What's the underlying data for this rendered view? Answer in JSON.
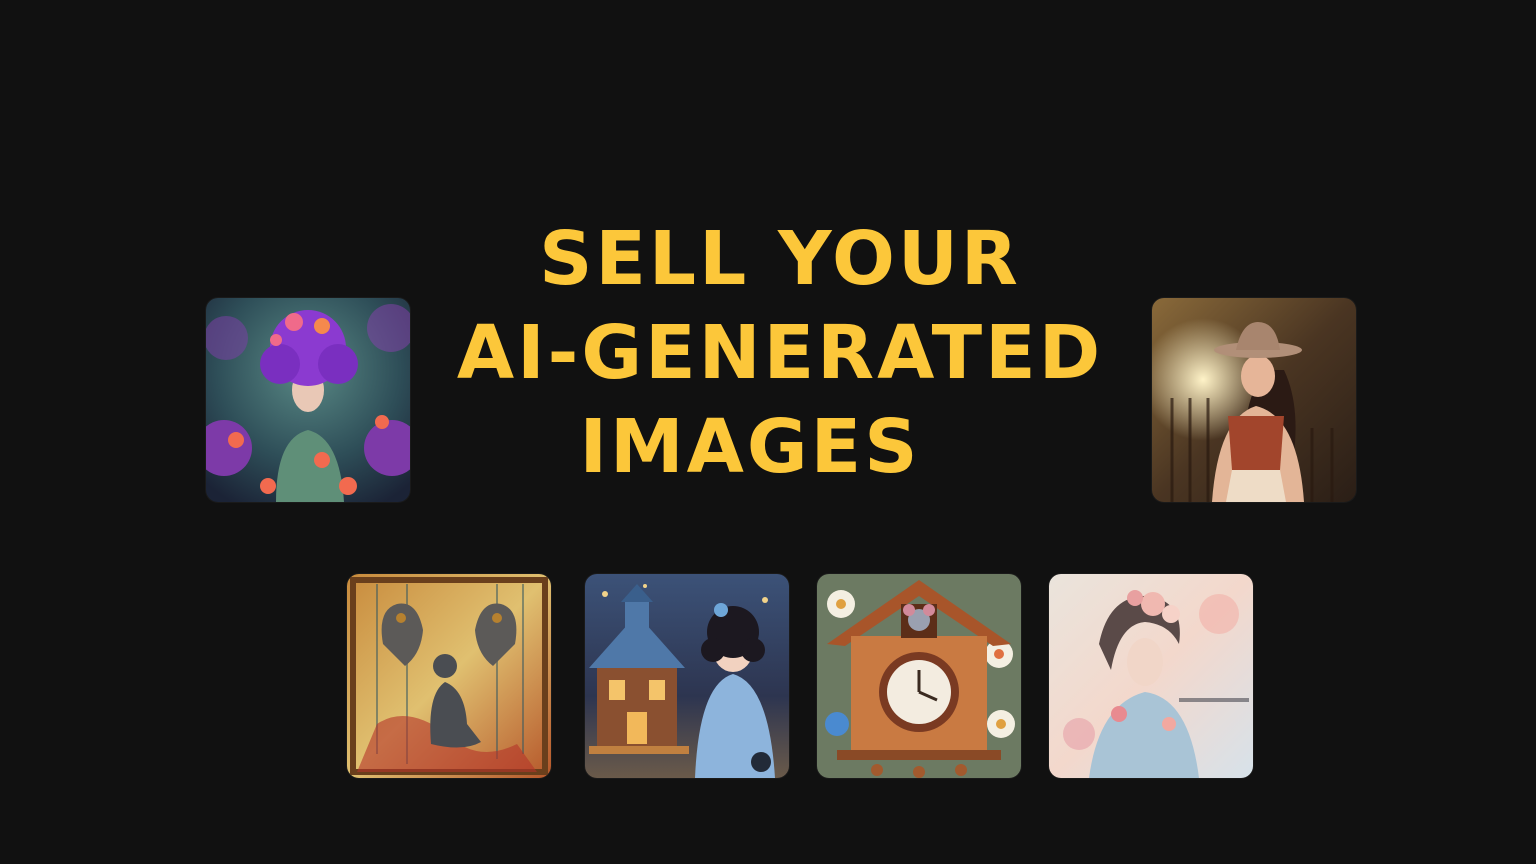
{
  "headline": {
    "line1": "SELL YOUR",
    "line2": "AI-GENERATED",
    "line3": "IMAGES"
  },
  "colors": {
    "background": "#111111",
    "headline": "#fcc73a"
  },
  "images": [
    {
      "id": "purple-flower-hair-woman-image"
    },
    {
      "id": "woman-in-sun-hat-image"
    },
    {
      "id": "praying-child-with-hands-image"
    },
    {
      "id": "girl-with-dollhouse-image"
    },
    {
      "id": "cuckoo-clock-with-mouse-image"
    },
    {
      "id": "watercolor-floral-woman-image"
    }
  ]
}
